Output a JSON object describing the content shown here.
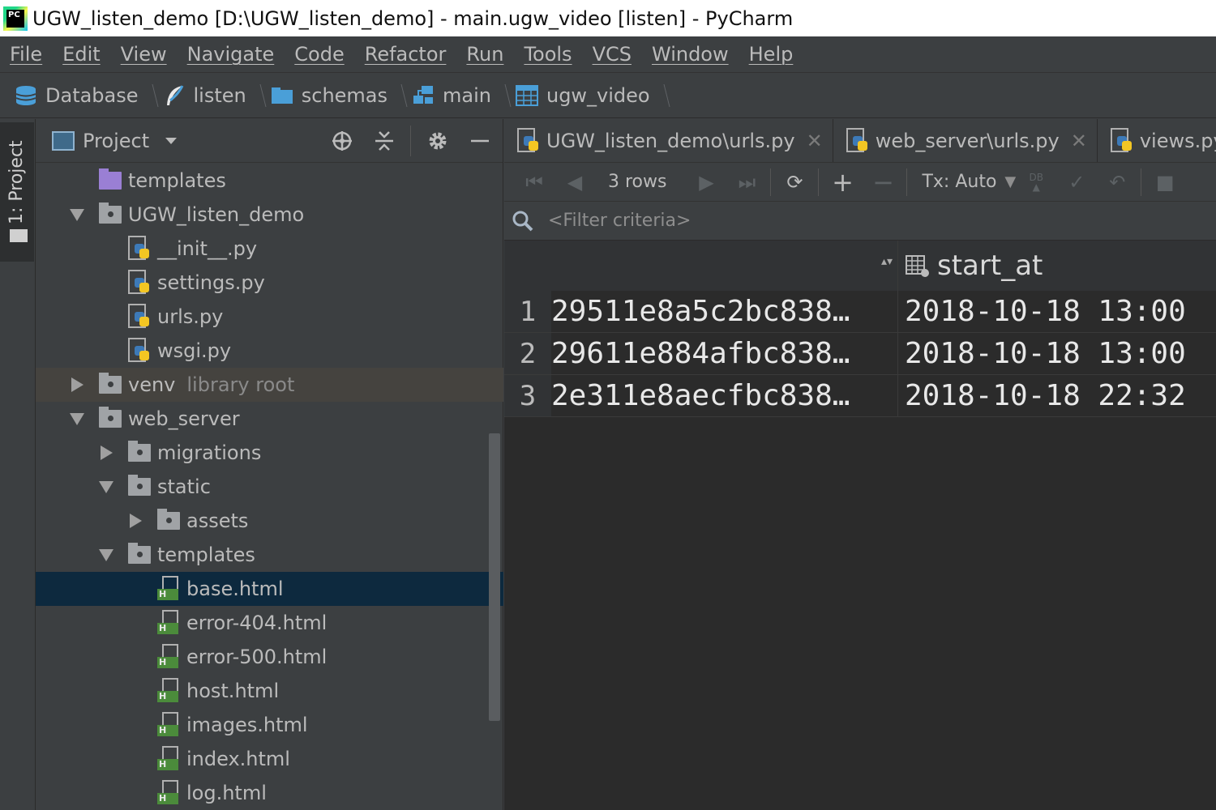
{
  "window": {
    "title": "UGW_listen_demo [D:\\UGW_listen_demo] - main.ugw_video [listen] - PyCharm",
    "logo_text": "PC"
  },
  "menu": [
    "File",
    "Edit",
    "View",
    "Navigate",
    "Code",
    "Refactor",
    "Run",
    "Tools",
    "VCS",
    "Window",
    "Help"
  ],
  "breadcrumb": [
    "Database",
    "listen",
    "schemas",
    "main",
    "ugw_video"
  ],
  "toolstripe": {
    "project_tab": "1: Project"
  },
  "project": {
    "title": "Project",
    "tree": [
      {
        "label": "templates",
        "kind": "folder-purple"
      },
      {
        "label": "UGW_listen_demo",
        "kind": "folder"
      },
      {
        "label": "__init__.py",
        "kind": "py"
      },
      {
        "label": "settings.py",
        "kind": "py"
      },
      {
        "label": "urls.py",
        "kind": "py"
      },
      {
        "label": "wsgi.py",
        "kind": "py"
      },
      {
        "label": "venv",
        "kind": "folder",
        "suffix": "library root"
      },
      {
        "label": "web_server",
        "kind": "folder"
      },
      {
        "label": "migrations",
        "kind": "folder"
      },
      {
        "label": "static",
        "kind": "folder"
      },
      {
        "label": "assets",
        "kind": "folder"
      },
      {
        "label": "templates",
        "kind": "folder"
      },
      {
        "label": "base.html",
        "kind": "html"
      },
      {
        "label": "error-404.html",
        "kind": "html"
      },
      {
        "label": "error-500.html",
        "kind": "html"
      },
      {
        "label": "host.html",
        "kind": "html"
      },
      {
        "label": "images.html",
        "kind": "html"
      },
      {
        "label": "index.html",
        "kind": "html"
      },
      {
        "label": "log.html",
        "kind": "html"
      }
    ]
  },
  "editor": {
    "tabs": [
      "UGW_listen_demo\\urls.py",
      "web_server\\urls.py",
      "views.py"
    ],
    "toolbar": {
      "rows": "3 rows",
      "tx": "Tx: Auto",
      "db": "DB"
    },
    "filter_placeholder": "<Filter criteria>",
    "grid": {
      "columns": [
        "",
        "start_at"
      ],
      "rows": [
        {
          "n": "1",
          "id": "29511e8a5c2bc838…",
          "start_at": "2018-10-18 13:00"
        },
        {
          "n": "2",
          "id": "29611e884afbc838…",
          "start_at": "2018-10-18 13:00"
        },
        {
          "n": "3",
          "id": "2e311e8aecfbc838…",
          "start_at": "2018-10-18 22:32"
        }
      ]
    }
  }
}
